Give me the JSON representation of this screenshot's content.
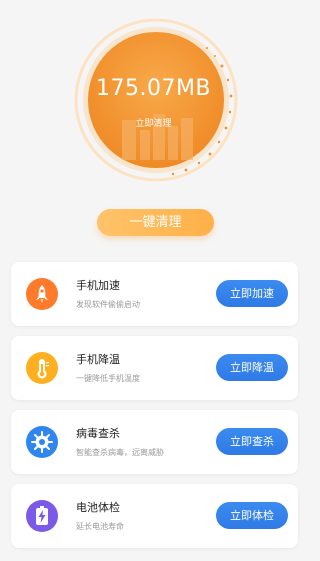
{
  "hero": {
    "junk_size": "175.07MB",
    "clean_now": "立即清理"
  },
  "one_key_clean": "一键清理",
  "features": [
    {
      "title": "手机加速",
      "subtitle": "发现软件偷偷启动",
      "button": "立即加速",
      "icon": "rocket-icon",
      "color": "#ff7a2a"
    },
    {
      "title": "手机降温",
      "subtitle": "一键降低手机温度",
      "button": "立即降温",
      "icon": "thermometer-icon",
      "color": "#ffb020"
    },
    {
      "title": "病毒查杀",
      "subtitle": "智能查杀病毒，远离威胁",
      "button": "立即查杀",
      "icon": "virus-icon",
      "color": "#2f86f0"
    },
    {
      "title": "电池体检",
      "subtitle": "延长电池寿命",
      "button": "立即体检",
      "icon": "battery-icon",
      "color": "#7b5ae8"
    }
  ],
  "colors": {
    "accent_orange": "#f0902a",
    "button_blue": "#2f7ae6",
    "background": "#f5f5f5"
  }
}
